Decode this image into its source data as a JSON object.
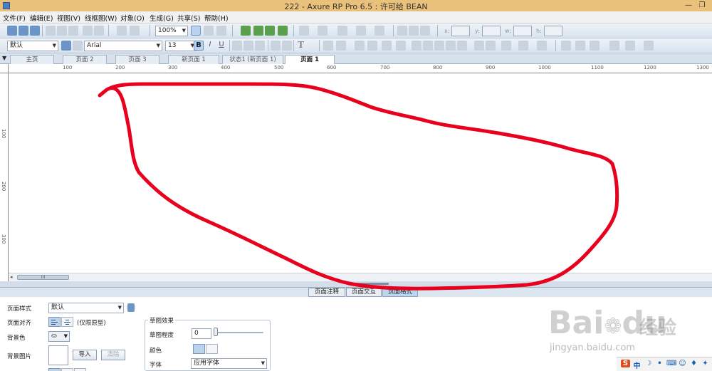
{
  "window": {
    "title": "222 - Axure RP Pro 6.5 : 许可给 BEAN",
    "min": "—",
    "restore": "❐"
  },
  "menu": [
    "文件(F)",
    "编辑(E)",
    "视图(V)",
    "线框图(W)",
    "对象(O)",
    "生成(G)",
    "共享(S)",
    "帮助(H)"
  ],
  "toolbar": {
    "zoom": "100%",
    "x_label": "x:",
    "y_label": "y:",
    "w_label": "w:",
    "h_label": "h:",
    "style_select": "默认",
    "font_select": "Arial",
    "size_select": "13",
    "text_tool": "T",
    "bold": "B",
    "italic": "I",
    "underline": "U"
  },
  "page_tabs": {
    "items": [
      "主页",
      "页面 2",
      "页面 3",
      "新页面 1",
      "状态1 (新页面 1)",
      "页面 1"
    ],
    "active_index": 5
  },
  "ruler": {
    "h_labels": [
      "100",
      "200",
      "300",
      "400",
      "500",
      "600",
      "700",
      "800",
      "900",
      "1000",
      "1100",
      "1200",
      "1300"
    ],
    "v_labels": [
      "100",
      "200",
      "300"
    ]
  },
  "hscroll": {
    "thumb_grip": "III"
  },
  "properties_tabs": {
    "items": [
      "页面注释",
      "页面交互",
      "页面格式"
    ],
    "active_index": 2
  },
  "page_format": {
    "page_style_label": "页面样式",
    "page_style_value": "默认",
    "align_label": "页面对齐",
    "align_note": "(仅限原型)",
    "bg_color_label": "背景色",
    "bg_image_label": "背景图片",
    "import_button": "导入",
    "clear_button": "清除",
    "sketch_group_title": "草图效果",
    "sketch_level_label": "草图程度",
    "sketch_level_value": "0",
    "color_label": "颜色",
    "font_label": "字体",
    "font_value": "应用字体"
  },
  "watermark": {
    "brand": "Bai",
    "brand2": "du",
    "cn": "经验",
    "url": "jingyan.baidu.com"
  },
  "tray": {
    "ime_s": "S",
    "ime_zh": "中"
  },
  "colors": {
    "scribble": "#e8001c",
    "titlebar": "#e9c17a"
  }
}
